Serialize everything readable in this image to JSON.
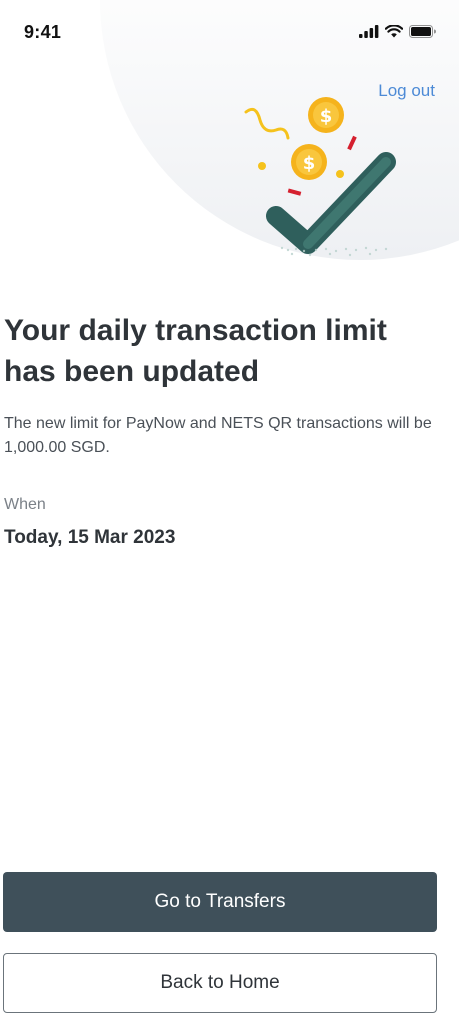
{
  "status_bar": {
    "time": "9:41",
    "icons": [
      "cellular-signal-icon",
      "wifi-icon",
      "battery-icon"
    ]
  },
  "header": {
    "logout_label": "Log out"
  },
  "illustration": {
    "icons": [
      "success-check-icon",
      "coin-icon",
      "confetti-icon"
    ],
    "colors": {
      "check": "#2f5f5c",
      "coin": "#f5b31c",
      "confetti_red": "#d5202f",
      "confetti_yellow": "#f5c21c"
    }
  },
  "main": {
    "title": "Your daily transaction limit has been updated",
    "description": "The new limit for  PayNow and NETS QR transactions will be 1,000.00 SGD.",
    "when_label": "When",
    "when_value": "Today, 15 Mar 2023"
  },
  "actions": {
    "primary_label": "Go to Transfers",
    "secondary_label": "Back to Home"
  },
  "colors": {
    "accent_link": "#4d8ad6",
    "primary_button": "#3f505a"
  }
}
